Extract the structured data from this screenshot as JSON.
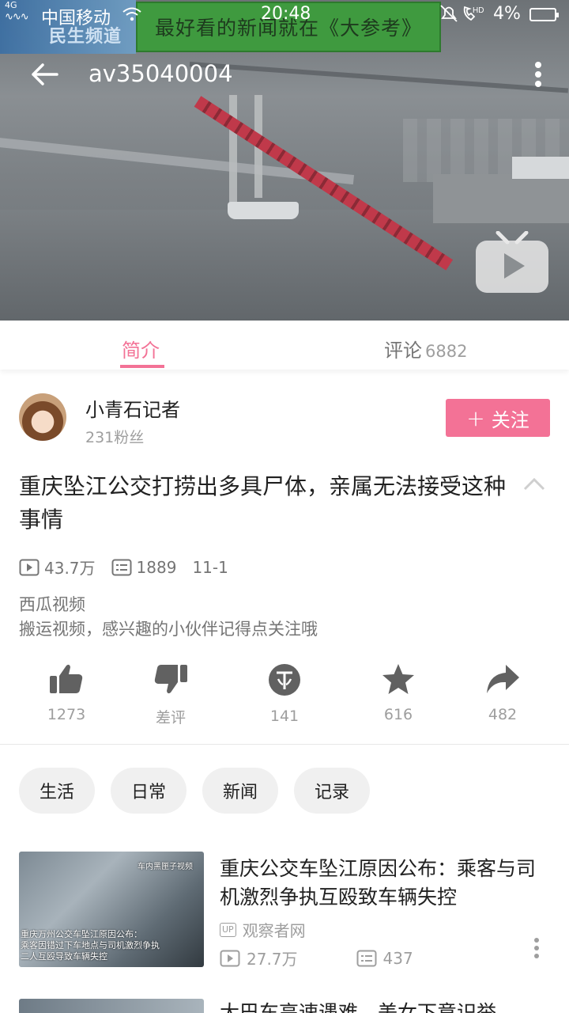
{
  "status_bar": {
    "network": "4G",
    "carrier": "中国移动",
    "time": "20:48",
    "signal_icons": "HD",
    "battery": "4%"
  },
  "video": {
    "channel_logo": "民生频道",
    "banner": "最好看的新闻就在《大参考》",
    "title": "av35040004"
  },
  "tabs": {
    "intro": "简介",
    "comments": "评论",
    "comments_count": "6882"
  },
  "uploader": {
    "name": "小青石记者",
    "fans": "231粉丝",
    "follow_label": "关注"
  },
  "content": {
    "title": "重庆坠江公交打捞出多具尸体，亲属无法接受这种事情",
    "views": "43.7万",
    "danmaku": "1889",
    "date": "11-1",
    "source": "西瓜视频",
    "description": "搬运视频，感兴趣的小伙伴记得点关注哦"
  },
  "actions": {
    "like": "1273",
    "dislike": "差评",
    "coin": "141",
    "favorite": "616",
    "share": "482"
  },
  "tags": [
    "生活",
    "日常",
    "新闻",
    "记录"
  ],
  "related": [
    {
      "thumb_header": "车内黑匣子视频",
      "thumb_caption_1": "重庆万州公交车坠江原因公布：",
      "thumb_caption_2": "乘客因错过下车地点与司机激烈争执",
      "thumb_caption_3": "二人互殴导致车辆失控",
      "title": "重庆公交车坠江原因公布：乘客与司机激烈争执互殴致车辆失控",
      "up_badge": "UP",
      "uploader": "观察者网",
      "views": "27.7万",
      "danmaku": "437"
    },
    {
      "title": "大巴车高速遇难，美女下意识举"
    }
  ],
  "colors": {
    "accent": "#f37296",
    "text_primary": "#212121",
    "text_secondary": "#9e9e9e",
    "icon": "#757575"
  }
}
